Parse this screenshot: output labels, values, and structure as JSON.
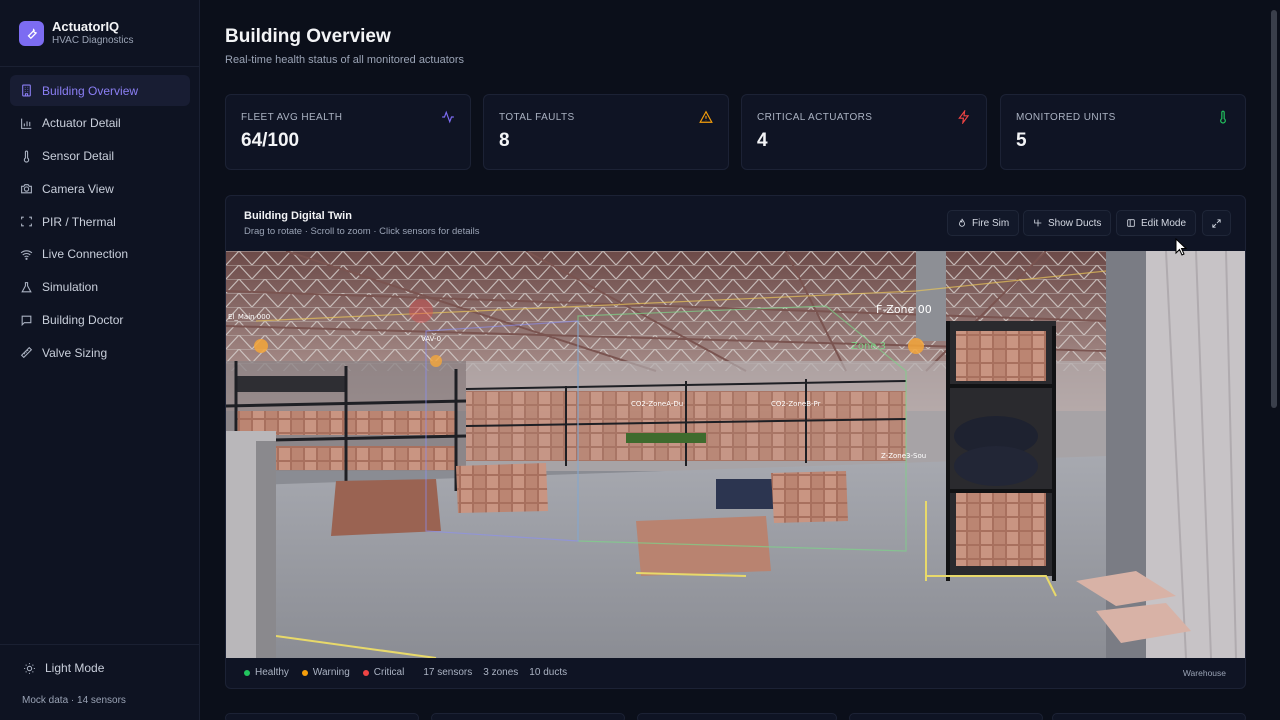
{
  "app": {
    "name": "ActuatorIQ",
    "subtitle": "HVAC Diagnostics"
  },
  "sidebar": {
    "items": [
      {
        "label": "Building Overview",
        "icon": "building-icon",
        "active": true
      },
      {
        "label": "Actuator Detail",
        "icon": "bar-chart-icon"
      },
      {
        "label": "Sensor Detail",
        "icon": "thermometer-icon"
      },
      {
        "label": "Camera View",
        "icon": "camera-icon"
      },
      {
        "label": "PIR / Thermal",
        "icon": "scan-icon"
      },
      {
        "label": "Live Connection",
        "icon": "wifi-icon"
      },
      {
        "label": "Simulation",
        "icon": "flask-icon"
      },
      {
        "label": "Building Doctor",
        "icon": "message-icon"
      },
      {
        "label": "Valve Sizing",
        "icon": "ruler-icon"
      }
    ],
    "theme_toggle": "Light Mode",
    "footer": "Mock data · 14 sensors"
  },
  "page": {
    "title": "Building Overview",
    "subtitle": "Real-time health status of all monitored actuators"
  },
  "stats": [
    {
      "label": "FLEET AVG HEALTH",
      "value": "64/100",
      "icon": "activity-icon",
      "color": "#7c6cf2"
    },
    {
      "label": "TOTAL FAULTS",
      "value": "8",
      "icon": "warning-icon",
      "color": "#f59e0b"
    },
    {
      "label": "CRITICAL ACTUATORS",
      "value": "4",
      "icon": "zap-icon",
      "color": "#ef4444"
    },
    {
      "label": "MONITORED UNITS",
      "value": "5",
      "icon": "thermometer-icon",
      "color": "#22c55e"
    }
  ],
  "twin": {
    "title": "Building Digital Twin",
    "subtitle": "Drag to rotate · Scroll to zoom · Click sensors for details",
    "buttons": {
      "fire_sim": "Fire Sim",
      "show_ducts": "Show Ducts",
      "edit_mode": "Edit Mode"
    },
    "legend": [
      {
        "label": "Healthy",
        "color": "#22c55e"
      },
      {
        "label": "Warning",
        "color": "#f59e0b"
      },
      {
        "label": "Critical",
        "color": "#ef4444"
      }
    ],
    "counts": {
      "sensors": "17 sensors",
      "zones": "3 zones",
      "ducts": "10 ducts"
    },
    "scene": "Warehouse",
    "sensor_labels": [
      "El_Main 000",
      "VAV-0",
      "CO2-ZoneA-Du",
      "CO2-ZoneB-Pr",
      "F-Zone 00",
      "Zone 3",
      "Z-Zone3-Sou"
    ]
  }
}
